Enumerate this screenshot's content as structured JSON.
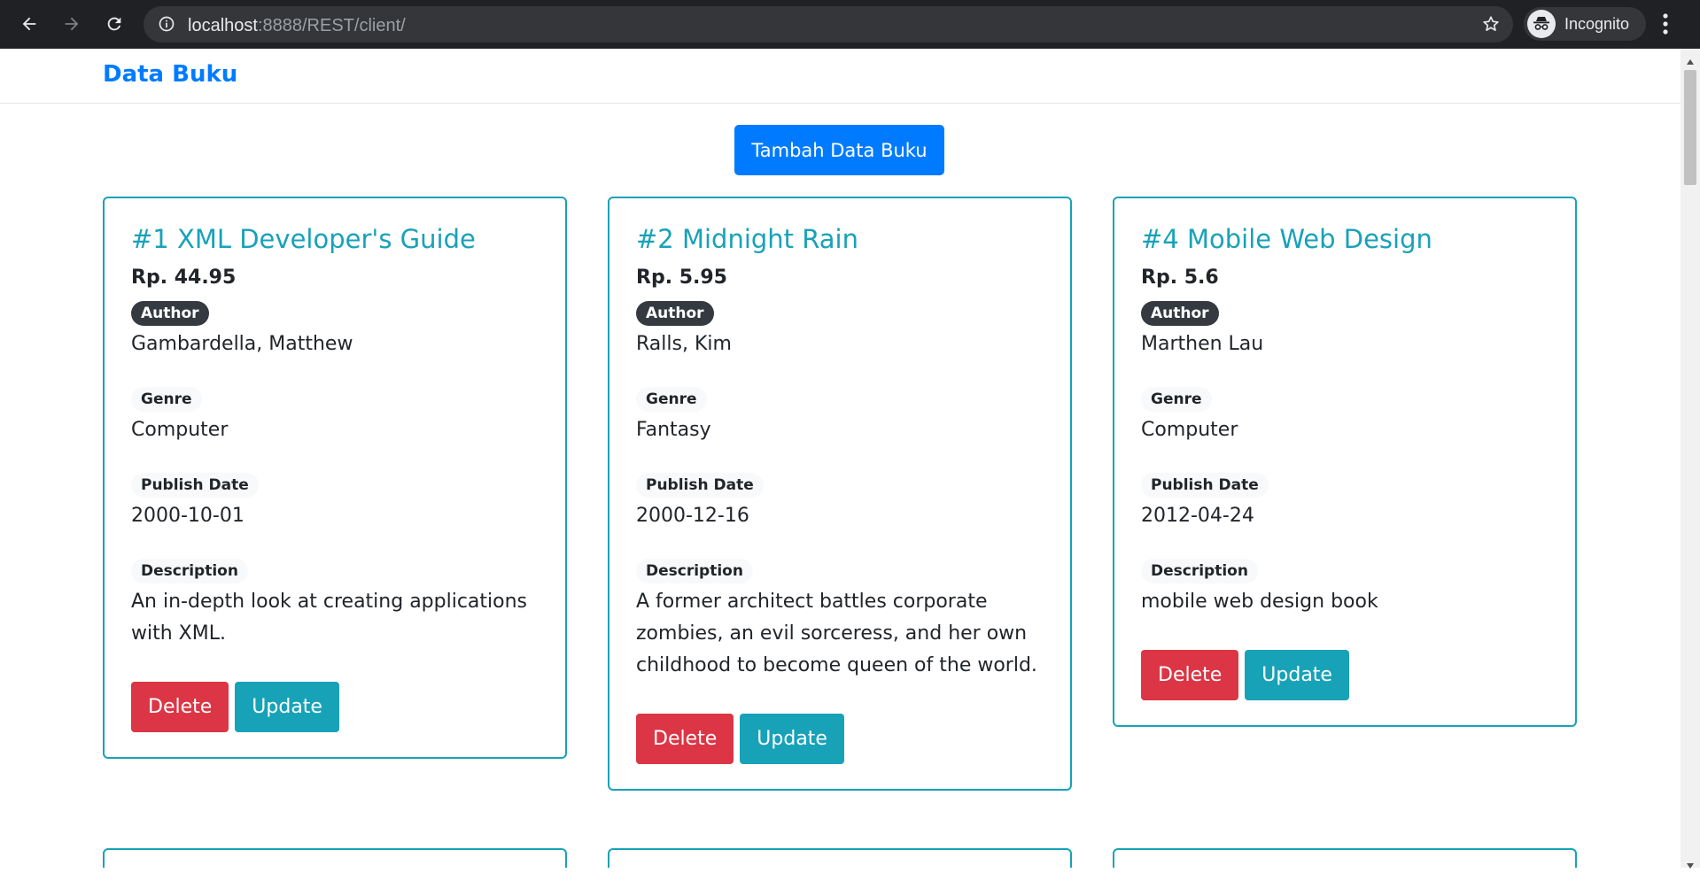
{
  "browser": {
    "url_host": "localhost",
    "url_rest": ":8888/REST/client/",
    "profile_label": "Incognito"
  },
  "navbar": {
    "brand": "Data Buku"
  },
  "add_button_label": "Tambah Data Buku",
  "labels": {
    "author": "Author",
    "genre": "Genre",
    "publish_date": "Publish Date",
    "description": "Description",
    "delete": "Delete",
    "update": "Update"
  },
  "books": [
    {
      "title": "#1 XML Developer's Guide",
      "price": "Rp. 44.95",
      "author": "Gambardella, Matthew",
      "genre": "Computer",
      "publish_date": "2000-10-01",
      "description": "An in-depth look at creating applications with XML."
    },
    {
      "title": "#2 Midnight Rain",
      "price": "Rp. 5.95",
      "author": "Ralls, Kim",
      "genre": "Fantasy",
      "publish_date": "2000-12-16",
      "description": "A former architect battles corporate zombies, an evil sorceress, and her own childhood to become queen of the world."
    },
    {
      "title": "#4 Mobile Web Design",
      "price": "Rp. 5.6",
      "author": "Marthen Lau",
      "genre": "Computer",
      "publish_date": "2012-04-24",
      "description": "mobile web design book"
    }
  ],
  "colors": {
    "primary": "#007bff",
    "info": "#17a2b8",
    "danger": "#dc3545",
    "dark_badge": "#343a40",
    "chrome_bg": "#202124"
  },
  "icons": [
    "back-arrow-icon",
    "forward-arrow-icon",
    "reload-icon",
    "info-icon",
    "star-icon",
    "incognito-icon",
    "more-vert-icon"
  ]
}
